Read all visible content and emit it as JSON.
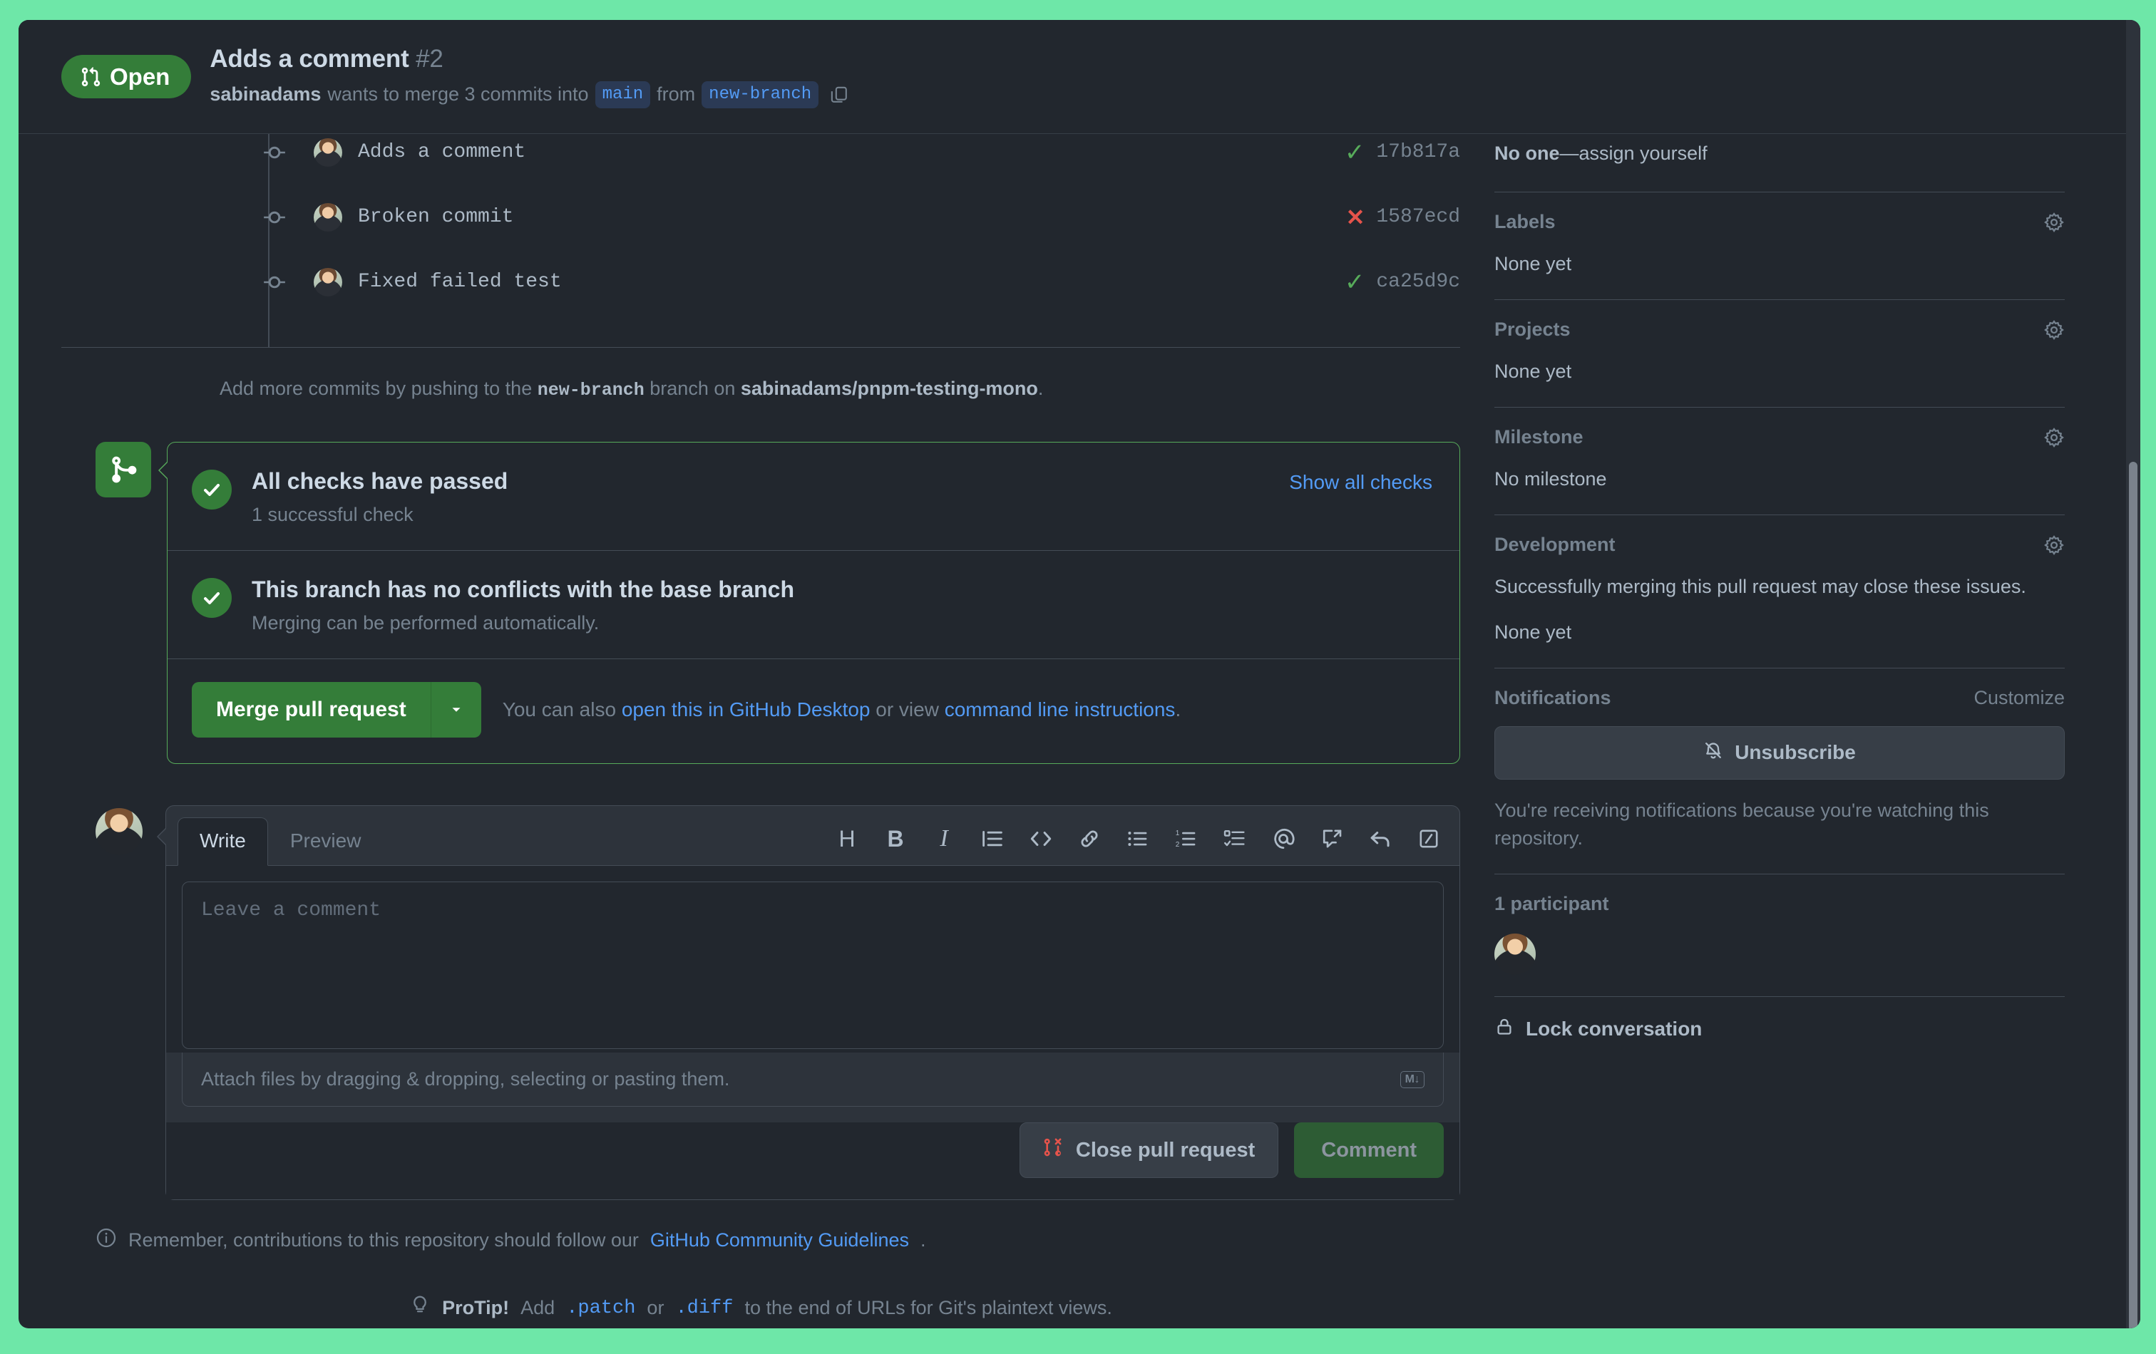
{
  "header": {
    "state_label": "Open",
    "state_color": "#347d39",
    "title": "Adds a comment",
    "number": "#2",
    "author": "sabinadams",
    "merge_phrase_1": "wants to merge 3 commits into",
    "base_branch": "main",
    "merge_phrase_2": "from",
    "head_branch": "new-branch",
    "copy_icon": "copy-icon"
  },
  "commits": [
    {
      "message": "Adds a comment",
      "sha": "17b817a",
      "status": "success",
      "status_glyph": "✓"
    },
    {
      "message": "Broken commit",
      "sha": "1587ecd",
      "status": "failure",
      "status_glyph": "✕"
    },
    {
      "message": "Fixed failed test",
      "sha": "ca25d9c",
      "status": "success",
      "status_glyph": "✓"
    }
  ],
  "push_hint": {
    "prefix": "Add more commits by pushing to the",
    "branch": "new-branch",
    "middle": "branch on",
    "repo": "sabinadams/pnpm-testing-mono",
    "suffix": "."
  },
  "merge_box": {
    "badge_icon": "git-merge-icon",
    "border_color": "#57ab5a",
    "checks": {
      "title": "All checks have passed",
      "subtitle": "1 successful check",
      "show_all_label": "Show all checks",
      "icon": "check-circle-icon"
    },
    "conflicts": {
      "title": "This branch has no conflicts with the base branch",
      "subtitle": "Merging can be performed automatically.",
      "icon": "check-circle-icon"
    },
    "actions": {
      "merge_label": "Merge pull request",
      "caret_icon": "chevron-down-icon",
      "alt_prefix": "You can also",
      "alt_link_1": "open this in GitHub Desktop",
      "alt_middle": "or view",
      "alt_link_2": "command line instructions",
      "alt_suffix": "."
    }
  },
  "composer": {
    "tabs": [
      {
        "label": "Write",
        "active": true
      },
      {
        "label": "Preview",
        "active": false
      }
    ],
    "toolbar": [
      {
        "name": "heading-icon",
        "glyph": "H"
      },
      {
        "name": "bold-icon",
        "glyph": "B"
      },
      {
        "name": "italic-icon",
        "glyph": "I"
      },
      {
        "name": "quote-icon",
        "glyph": "quote"
      },
      {
        "name": "code-icon",
        "glyph": "<>"
      },
      {
        "name": "link-icon",
        "glyph": "link"
      },
      {
        "name": "unordered-list-icon",
        "glyph": "ul"
      },
      {
        "name": "ordered-list-icon",
        "glyph": "ol"
      },
      {
        "name": "task-list-icon",
        "glyph": "task"
      },
      {
        "name": "mention-icon",
        "glyph": "@"
      },
      {
        "name": "reference-icon",
        "glyph": "ref"
      },
      {
        "name": "saved-reply-icon",
        "glyph": "reply"
      },
      {
        "name": "slash-command-icon",
        "glyph": "slash"
      }
    ],
    "placeholder": "Leave a comment",
    "value": "",
    "attach_text": "Attach files by dragging & dropping, selecting or pasting them.",
    "markdown_badge": "M↓",
    "close_pr_label": "Close pull request",
    "comment_label": "Comment",
    "comment_disabled": true
  },
  "footer": {
    "guidelines_prefix": "Remember, contributions to this repository should follow our",
    "guidelines_link": "GitHub Community Guidelines",
    "guidelines_suffix": ".",
    "info_icon": "info-icon",
    "protip_label": "ProTip!",
    "protip_prefix": "Add",
    "protip_code_1": ".patch",
    "protip_or": "or",
    "protip_code_2": ".diff",
    "protip_suffix": "to the end of URLs for Git's plaintext views.",
    "protip_icon": "lightbulb-icon"
  },
  "sidebar": {
    "assignees": {
      "value_bold": "No one",
      "value_dash": "—",
      "value_link": "assign yourself"
    },
    "sections": [
      {
        "title": "Labels",
        "value": "None yet",
        "gear": "gear-icon"
      },
      {
        "title": "Projects",
        "value": "None yet",
        "gear": "gear-icon"
      },
      {
        "title": "Milestone",
        "value": "No milestone",
        "gear": "gear-icon"
      }
    ],
    "development": {
      "title": "Development",
      "gear": "gear-icon",
      "description": "Successfully merging this pull request may close these issues.",
      "value": "None yet"
    },
    "notifications": {
      "title": "Notifications",
      "customize_label": "Customize",
      "button_label": "Unsubscribe",
      "button_icon": "bell-slash-icon",
      "note": "You're receiving notifications because you're watching this repository."
    },
    "participants": {
      "title": "1 participant",
      "avatar": "avatar-sabinadams"
    },
    "lock": {
      "label": "Lock conversation",
      "icon": "lock-icon"
    }
  }
}
